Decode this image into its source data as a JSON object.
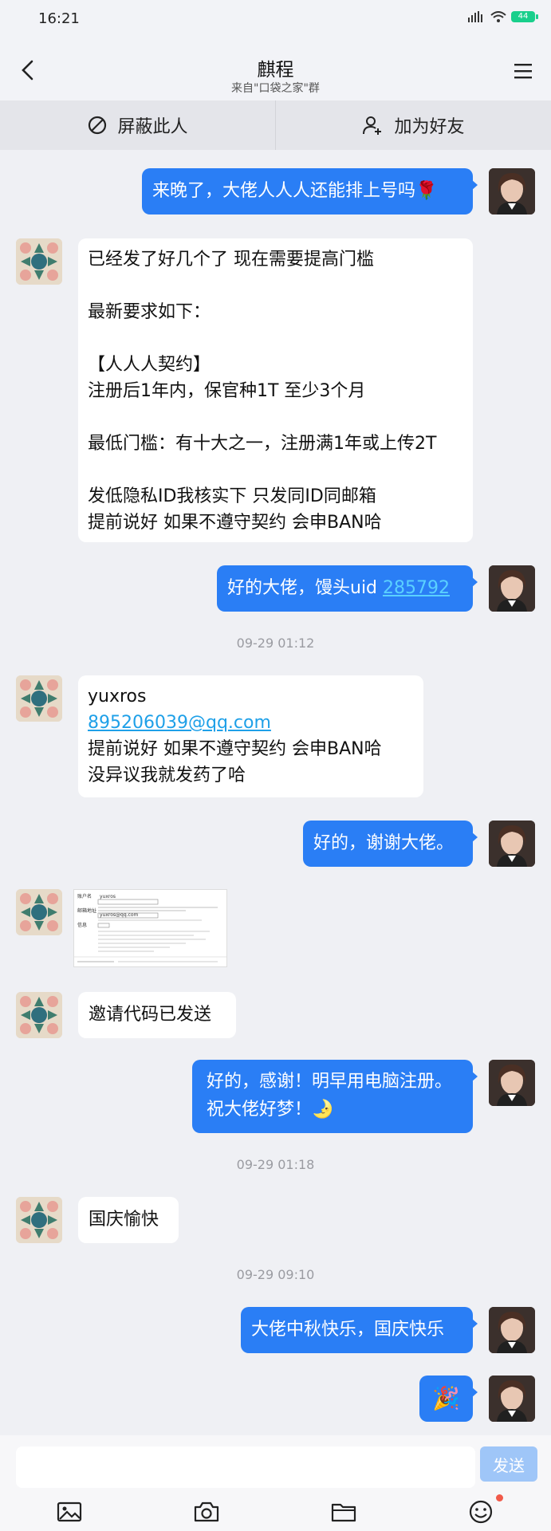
{
  "status": {
    "time": "16:21",
    "battery": "44"
  },
  "header": {
    "title": "麒程",
    "subtitle": "来自\"口袋之家\"群"
  },
  "actions": {
    "block": "屏蔽此人",
    "add_friend": "加为好友"
  },
  "messages": {
    "m1": "来晚了，大佬人人人还能排上号吗🌹",
    "m2": [
      "已经发了好几个了 现在需要提高门槛",
      "",
      "最新要求如下：",
      "",
      "【人人人契约】",
      "注册后1年内，保官种1T 至少3个月",
      "",
      "最低门槛：有十大之一，注册满1年或上传2T",
      "",
      "发低隐私ID我核实下 只发同ID同邮箱",
      "提前说好 如果不遵守契约 会申BAN哈"
    ],
    "m3_prefix": "好的大佬，馒头uid ",
    "m3_uid": "285792",
    "m4_user": "yuxros",
    "m4_email": "895206039@qq.com",
    "m4_line3": "提前说好 如果不遵守契约 会申BAN哈",
    "m4_line4": "没异议我就发药了哈",
    "m5": "好的，谢谢大佬。",
    "m7": "邀请代码已发送",
    "m8_line1": "好的，感谢！明早用电脑注册。",
    "m8_line2": "祝大佬好梦！🌛",
    "m9": "国庆愉快",
    "m10": "大佬中秋快乐，国庆快乐",
    "m11": "🎉"
  },
  "timestamps": {
    "t1": "09-29 01:12",
    "t2": "09-29 01:18",
    "t3": "09-29 09:10"
  },
  "thumb": {
    "r1_label": "账户名",
    "r1_value": "yuxros",
    "r2_label": "邮箱地址",
    "r2_value": "yuxros@qq.com",
    "r3_label": "信息"
  },
  "input": {
    "placeholder": "",
    "send": "发送"
  },
  "colors": {
    "bubble_me": "#2a7ef5",
    "background": "#eff0f4",
    "link": "#1ea0e8"
  }
}
